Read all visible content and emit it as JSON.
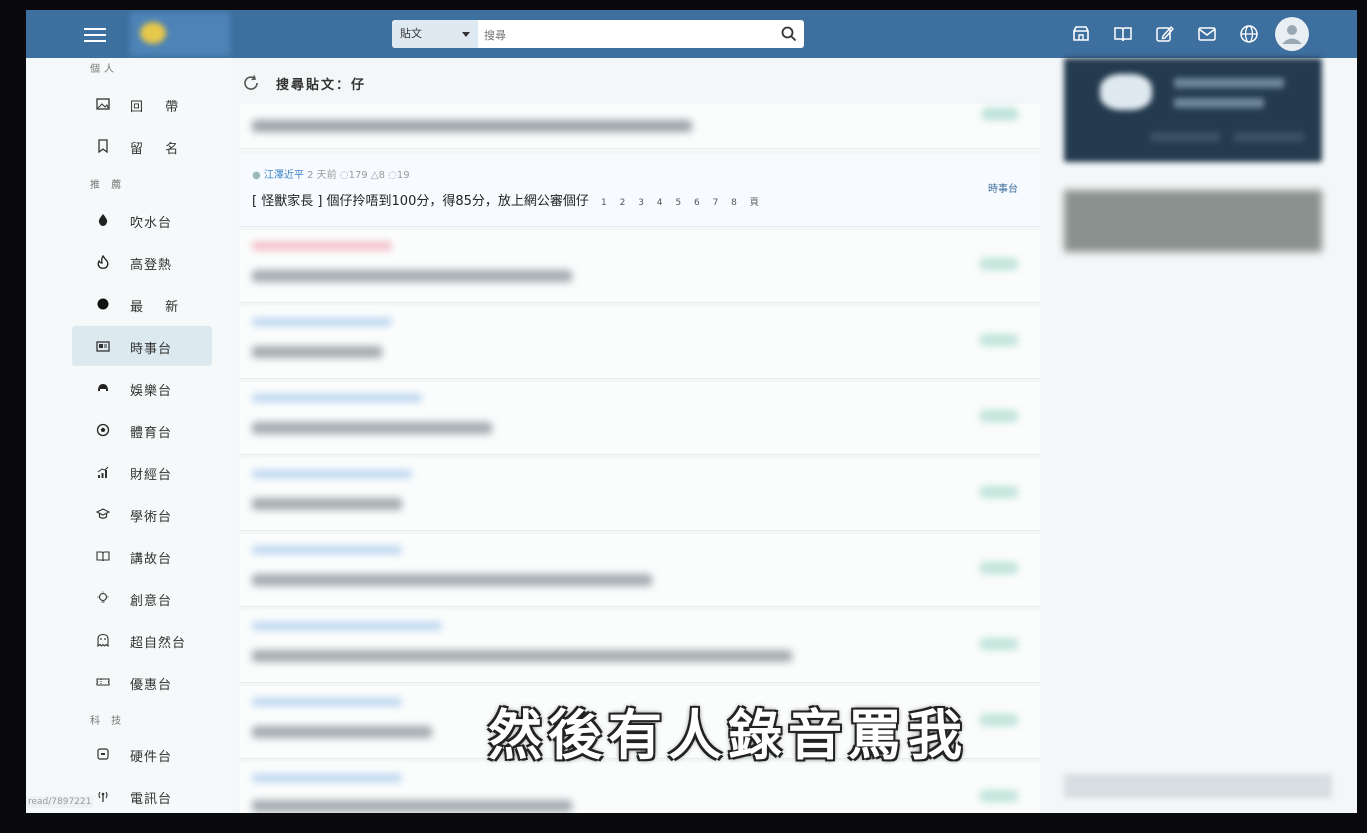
{
  "search": {
    "scope_label": "貼文",
    "placeholder": "搜尋"
  },
  "sidebar": {
    "section_personal": "個人",
    "personal_items": [
      {
        "label": "回 帶",
        "icon": "image-icon"
      },
      {
        "label": "留 名",
        "icon": "bookmark-icon"
      }
    ],
    "section_recommend": "推 薦",
    "recommend_items": [
      {
        "label": "吹水台",
        "icon": "droplet-icon"
      },
      {
        "label": "高登熱",
        "icon": "fire-icon"
      },
      {
        "label": "最 新",
        "icon": "dot-icon"
      }
    ],
    "channel_items": [
      {
        "label": "時事台",
        "icon": "newspaper-icon",
        "active": true
      },
      {
        "label": "娛樂台",
        "icon": "helmet-icon"
      },
      {
        "label": "體育台",
        "icon": "soccer-icon"
      },
      {
        "label": "財經台",
        "icon": "signal-bars-icon"
      },
      {
        "label": "學術台",
        "icon": "grad-cap-icon"
      },
      {
        "label": "講故台",
        "icon": "book-icon"
      },
      {
        "label": "創意台",
        "icon": "bulb-icon"
      },
      {
        "label": "超自然台",
        "icon": "ghost-icon"
      },
      {
        "label": "優惠台",
        "icon": "ticket-icon"
      }
    ],
    "section_tech": "科 技",
    "tech_items": [
      {
        "label": "硬件台",
        "icon": "chip-icon"
      },
      {
        "label": "電訊台",
        "icon": "antenna-icon"
      }
    ],
    "url_tip": "read/7897221"
  },
  "main": {
    "heading": "搜尋貼文：仔",
    "highlight_post": {
      "author": "江澤近平",
      "time": "2 天前",
      "views": "179",
      "likes": "8",
      "comments": "19",
      "title": "[ 怪獸家長 ] 個仔拎唔到100分，得85分，放上網公審個仔",
      "pages": "1 2 3 4 5 6 7 8 頁",
      "channel": "時事台"
    }
  },
  "subtitle": "然後有人錄音罵我",
  "colors": {
    "topbar": "#3d6f9f",
    "accent_link": "#3d84c6",
    "active_item_bg": "#dce9ee"
  }
}
